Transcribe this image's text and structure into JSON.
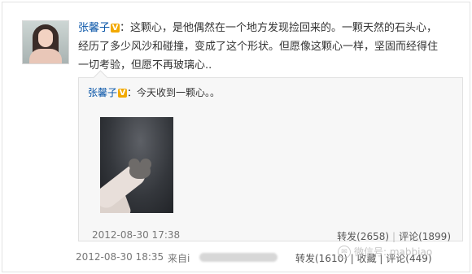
{
  "post": {
    "author": "张馨子",
    "verified_badge": "V",
    "colon": "：",
    "text": "这颗心，是他偶然在一个地方发现捡回来的。一颗天然的石头心，经历了多少风沙和碰撞，变成了这个形状。但愿像这颗心一样，坚固而经得住一切考验，但愿不再玻璃心..",
    "timestamp": "2012-08-30 18:35",
    "source_prefix": "来自i",
    "reposts_label": "转发(1610)",
    "comments_label": "| 收藏 | 评论(449)"
  },
  "repost": {
    "author": "张馨子",
    "verified_badge": "V",
    "colon": "：",
    "text": "今天收到一颗心。。",
    "timestamp": "2012-08-30 17:38",
    "reposts_label": "转发(2658)",
    "separator": "|",
    "comments_label": "评论(1899)"
  },
  "watermark": {
    "icon": "wechat-icon",
    "text": "微信号: mabbiao"
  },
  "colors": {
    "link": "#0a56a8",
    "badge": "#f2a900",
    "repost_bg": "#f7f7f7"
  }
}
